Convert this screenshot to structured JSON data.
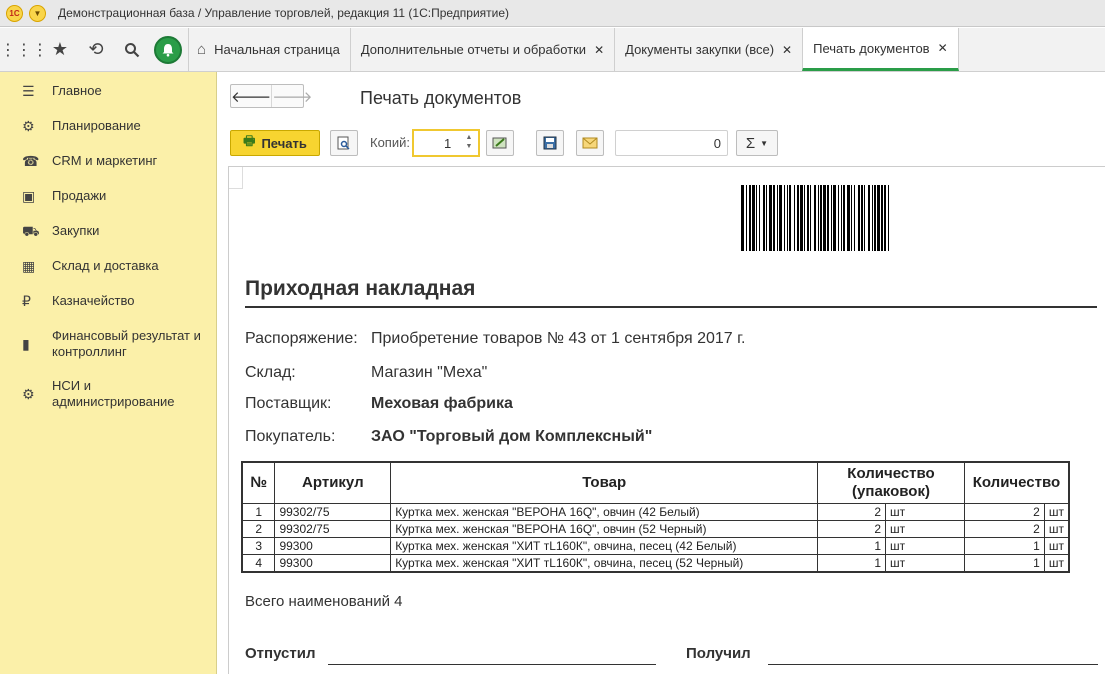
{
  "window": {
    "title": "Демонстрационная база / Управление торговлей, редакция 11  (1С:Предприятие)",
    "logo": "1С"
  },
  "tabs": [
    {
      "label": "Начальная страница"
    },
    {
      "label": "Дополнительные отчеты и обработки"
    },
    {
      "label": "Документы закупки (все)"
    },
    {
      "label": "Печать документов"
    }
  ],
  "sidebar": {
    "items": [
      {
        "label": "Главное",
        "icon": "menu-icon"
      },
      {
        "label": "Планирование",
        "icon": "planning-icon"
      },
      {
        "label": "CRM и маркетинг",
        "icon": "crm-icon"
      },
      {
        "label": "Продажи",
        "icon": "shopping-bag-icon"
      },
      {
        "label": "Закупки",
        "icon": "cart-icon"
      },
      {
        "label": "Склад и доставка",
        "icon": "warehouse-icon"
      },
      {
        "label": "Казначейство",
        "icon": "ruble-icon"
      },
      {
        "label": "Финансовый результат и контроллинг",
        "icon": "bar-chart-icon"
      },
      {
        "label": "НСИ и администрирование",
        "icon": "gear-icon"
      }
    ]
  },
  "page": {
    "title": "Печать документов"
  },
  "toolbar": {
    "print_label": "Печать",
    "copies_label": "Копий:",
    "copies_value": "1",
    "sum_value": "0",
    "sum_symbol": "Σ"
  },
  "document": {
    "title": "Приходная накладная",
    "fields": [
      {
        "label": "Распоряжение:",
        "value": "Приобретение товаров № 43 от 1 сентября 2017 г.",
        "bold": false
      },
      {
        "label": "Склад:",
        "value": "Магазин \"Меха\"",
        "bold": false
      },
      {
        "label": "Поставщик:",
        "value": "Меховая фабрика",
        "bold": true
      },
      {
        "label": "Покупатель:",
        "value": "ЗАО \"Торговый дом Комплексный\"",
        "bold": true
      }
    ],
    "table": {
      "headers": [
        "№",
        "Артикул",
        "Товар",
        "Количество (упаковок)",
        "Количество"
      ],
      "rows": [
        {
          "n": "1",
          "sku": "99302/75",
          "item": "Куртка мех. женская \"ВЕРОНА 16Q\", овчин (42 Белый)",
          "qty_pack": "2",
          "unit_pack": "шт",
          "qty": "2",
          "unit": "шт"
        },
        {
          "n": "2",
          "sku": "99302/75",
          "item": "Куртка мех. женская \"ВЕРОНА 16Q\", овчин (52 Черный)",
          "qty_pack": "2",
          "unit_pack": "шт",
          "qty": "2",
          "unit": "шт"
        },
        {
          "n": "3",
          "sku": "99300",
          "item": "Куртка мех. женская \"ХИТ тL160К\", овчина, песец (42 Белый)",
          "qty_pack": "1",
          "unit_pack": "шт",
          "qty": "1",
          "unit": "шт"
        },
        {
          "n": "4",
          "sku": "99300",
          "item": "Куртка мех. женская \"ХИТ тL160К\", овчина, песец (52 Черный)",
          "qty_pack": "1",
          "unit_pack": "шт",
          "qty": "1",
          "unit": "шт"
        }
      ]
    },
    "total_label": "Всего наименований 4",
    "signatures": {
      "released": "Отпустил",
      "received": "Получил"
    }
  }
}
